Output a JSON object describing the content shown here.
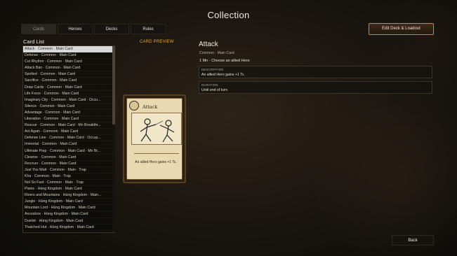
{
  "title": "Collection",
  "tabs": [
    {
      "label": "Cards"
    },
    {
      "label": "Heroes"
    },
    {
      "label": "Decks"
    },
    {
      "label": "Rules"
    }
  ],
  "edit_button": "Edit Deck & Loadout",
  "card_list": {
    "label": "Card List",
    "items": [
      "Attack  ·  Common  ·  Main Card",
      "Defense  ·  Common  ·  Main Card",
      "Cut Rhythm  ·  Common  ·  Main Card",
      "Attack Ban  ·  Common  ·  Main Card",
      "Spotted  ·  Common  ·  Main Card",
      "Sacrifice  ·  Common  ·  Main Card",
      "Draw Cards  ·  Common  ·  Main Card",
      "Life Force  ·  Common  ·  Main Card",
      "Imaginary City  ·  Common  ·  Main Card  ·  Occu...",
      "Silence  ·  Common  ·  Main Card",
      "Advantage  ·  Common  ·  Main Card",
      "Liberation  ·  Common  ·  Main Card",
      "Rescue  ·  Common  ·  Main Card  ·  Mn Breakthr...",
      "Act Again  ·  Common  ·  Main Card",
      "Defense Line  ·  Common  ·  Main Card  ·  Occup...",
      "Immortal  ·  Common  ·  Main Card",
      "Ultimate Prep  ·  Common  ·  Main Card  ·  Mn Br...",
      "Cleanse  ·  Common  ·  Main Card",
      "Recover  ·  Common  ·  Main Card",
      "Just You Wait  ·  Common  ·  Main  ·  Trap",
      "Kha  ·  Common  ·  Main  ·  Trap",
      "Not So Fast  ·  Common  ·  Main  ·  Trap",
      "Plains  ·  Hùng Kingdom  ·  Main Card",
      "Rivers and Mountains  ·  Hùng Kingdom  ·  Main...",
      "Jungle  ·  Hùng Kingdom  ·  Main Card",
      "Mountain Lord  ·  Hùng Kingdom  ·  Main Card",
      "Ancestors  ·  Hùng Kingdom  ·  Main Card",
      "Duelist  ·  Hùng Kingdom  ·  Main Card",
      "Thatched Hut  ·  Hùng Kingdom  ·  Main Card"
    ]
  },
  "preview": {
    "label": "CARD PREVIEW",
    "card_title": "Attack",
    "card_text": "An allied Hero gains +1 Tc."
  },
  "detail": {
    "title": "Attack",
    "subtitle": "Common · Main Card",
    "cost": "1 Mn · Choose an allied Hero",
    "description_label": "DESCRIPTION",
    "description": "An allied Hero gains +1 Tc.",
    "duration_label": "DURATION",
    "duration": "Until end of turn."
  },
  "back_button": "Back",
  "colors": {
    "accent": "#e0a64a",
    "button_border": "#c58a3c",
    "selected_row": "#d8d8d8"
  }
}
